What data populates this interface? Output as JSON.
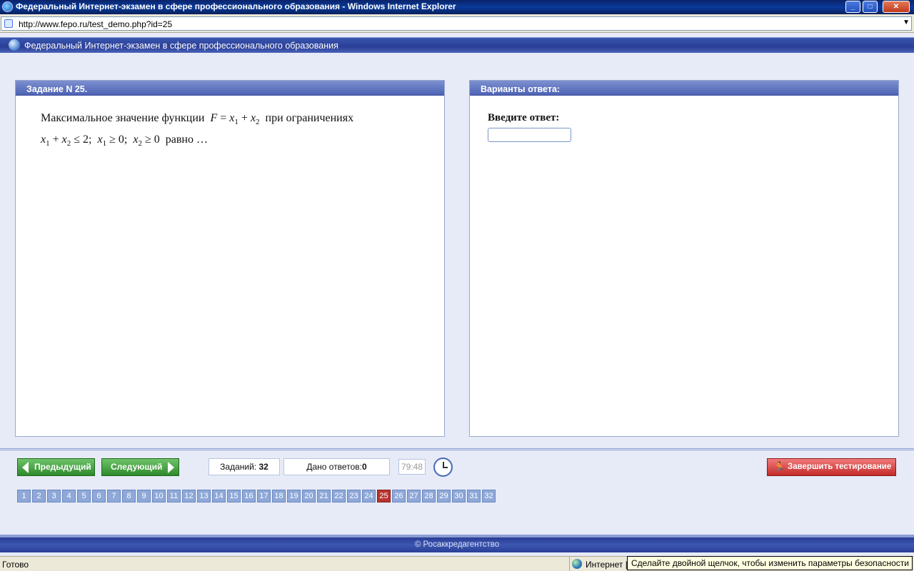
{
  "window": {
    "title": "Федеральный Интернет-экзамен в сфере профессионального образования - Windows Internet Explorer",
    "min": "_",
    "max": "□",
    "close": "✕"
  },
  "address": {
    "url": "http://www.fepo.ru/test_demo.php?id=25"
  },
  "app": {
    "title": "Федеральный Интернет-экзамен в сфере профессионального образования"
  },
  "task": {
    "heading": "Задание N 25.",
    "line1_prefix": "Максимальное значение функции",
    "line1_suffix": "при ограничениях",
    "line2_suffix": "равно …"
  },
  "answer": {
    "heading": "Варианты ответа:",
    "prompt": "Введите ответ:",
    "value": ""
  },
  "nav": {
    "prev_label": "Предыдущий",
    "next_label": "Следующий",
    "tasks_label": "Заданий:",
    "tasks_count": "32",
    "answers_label": "Дано ответов:",
    "answers_count": "0",
    "timer": "79:48",
    "finish_label": "Завершить тестирование"
  },
  "questions": {
    "items": [
      "1",
      "2",
      "3",
      "4",
      "5",
      "6",
      "7",
      "8",
      "9",
      "10",
      "11",
      "12",
      "13",
      "14",
      "15",
      "16",
      "17",
      "18",
      "19",
      "20",
      "21",
      "22",
      "23",
      "24",
      "25",
      "26",
      "27",
      "28",
      "29",
      "30",
      "31",
      "32"
    ],
    "active": "25"
  },
  "footer": {
    "text": "© Росаккредагентство"
  },
  "status": {
    "text": "Готово",
    "zone": "Интернет |",
    "tooltip": "Сделайте двойной щелчок, чтобы изменить параметры безопасности"
  }
}
